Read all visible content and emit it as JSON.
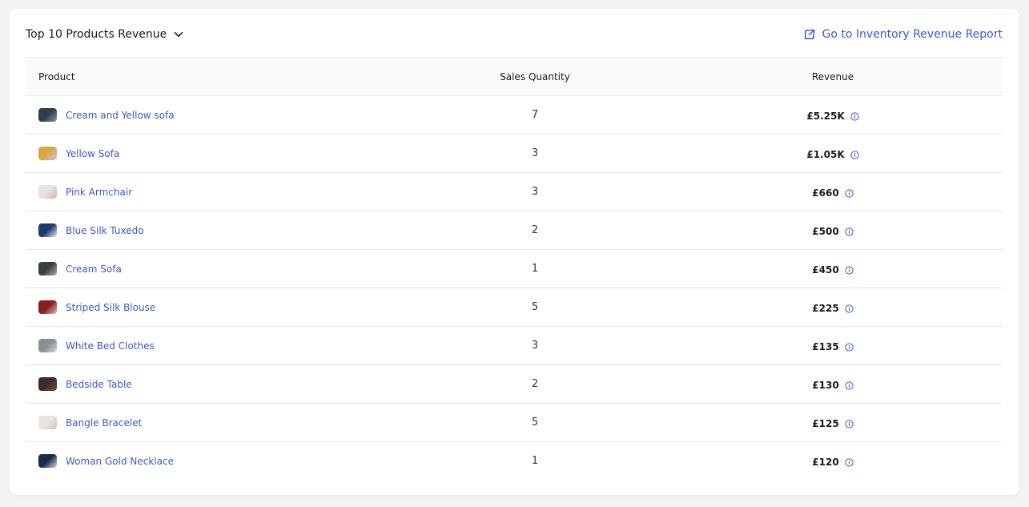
{
  "header": {
    "title": "Top 10 Products Revenue",
    "report_link": "Go to Inventory Revenue Report"
  },
  "table": {
    "columns": [
      "Product",
      "Sales Quantity",
      "Revenue"
    ],
    "rows": [
      {
        "name": "Cream and Yellow sofa",
        "qty": "7",
        "revenue": "£5.25K",
        "thumb_colors": [
          "#2e3e4a",
          "#8a9aa4"
        ]
      },
      {
        "name": "Yellow Sofa",
        "qty": "3",
        "revenue": "£1.05K",
        "thumb_colors": [
          "#d9a64a",
          "#c8ccd6"
        ]
      },
      {
        "name": "Pink Armchair",
        "qty": "3",
        "revenue": "£660",
        "thumb_colors": [
          "#e6e2e0",
          "#c9b3b0"
        ]
      },
      {
        "name": "Blue Silk Tuxedo",
        "qty": "2",
        "revenue": "£500",
        "thumb_colors": [
          "#1f3a6e",
          "#e8ecf2"
        ]
      },
      {
        "name": "Cream Sofa",
        "qty": "1",
        "revenue": "£450",
        "thumb_colors": [
          "#3c3f42",
          "#b7b3ac"
        ]
      },
      {
        "name": "Striped Silk Blouse",
        "qty": "5",
        "revenue": "£225",
        "thumb_colors": [
          "#8a1e22",
          "#d8c2b9"
        ]
      },
      {
        "name": "White Bed Clothes",
        "qty": "3",
        "revenue": "£135",
        "thumb_colors": [
          "#8b8f94",
          "#d9dbde"
        ]
      },
      {
        "name": "Bedside Table",
        "qty": "2",
        "revenue": "£130",
        "thumb_colors": [
          "#3a2e24",
          "#6a5542"
        ]
      },
      {
        "name": "Bangle Bracelet",
        "qty": "5",
        "revenue": "£125",
        "thumb_colors": [
          "#e8e6e2",
          "#c9c4ba"
        ]
      },
      {
        "name": "Woman Gold Necklace",
        "qty": "1",
        "revenue": "£120",
        "thumb_colors": [
          "#1c2a4a",
          "#d8dbe3"
        ]
      }
    ]
  },
  "colors": {
    "accent": "#3b57d9",
    "text": "#1a1a1a",
    "row_border": "#e6e6e6"
  },
  "icons": {
    "title_toggle": "chevron-down-icon",
    "report_link": "external-link-icon",
    "revenue_info": "info-icon"
  }
}
